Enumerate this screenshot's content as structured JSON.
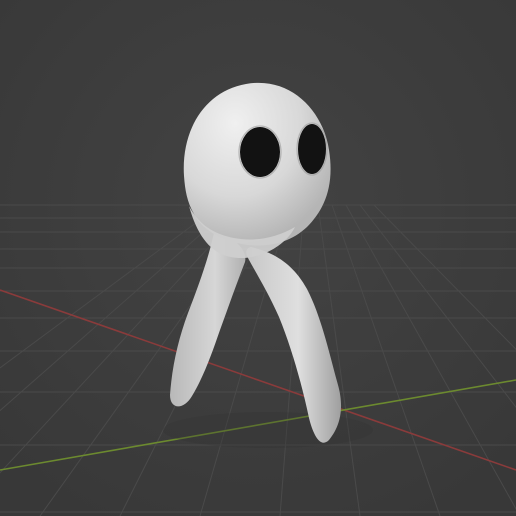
{
  "viewport": {
    "background_color": "#3d3d3d",
    "grid_color": "#4a4a4a",
    "x_axis_color": "#8a3b3b",
    "y_axis_color": "#6c8a2f",
    "object_color": "#d8d8d8",
    "eye_color": "#121212"
  },
  "scene": {
    "object_icon": "ghost-mesh-icon"
  }
}
